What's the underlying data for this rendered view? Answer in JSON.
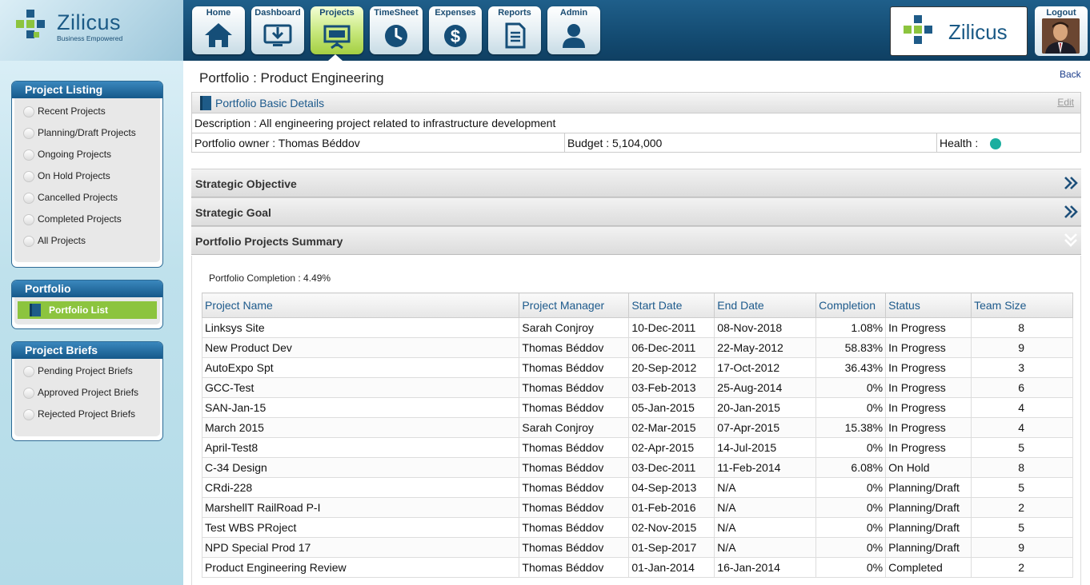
{
  "brand": {
    "name": "Zilicus",
    "tagline": "Business Empowered",
    "colors": {
      "green": "#8cc43e",
      "blue": "#1e5b88",
      "teal": "#1aae9f"
    }
  },
  "nav": {
    "items": [
      {
        "label": "Home",
        "icon": "home-icon"
      },
      {
        "label": "Dashboard",
        "icon": "dashboard-icon"
      },
      {
        "label": "Projects",
        "icon": "projects-icon",
        "active": true
      },
      {
        "label": "TimeSheet",
        "icon": "clock-icon"
      },
      {
        "label": "Expenses",
        "icon": "dollar-icon"
      },
      {
        "label": "Reports",
        "icon": "document-icon"
      },
      {
        "label": "Admin",
        "icon": "user-icon"
      }
    ],
    "logout_label": "Logout"
  },
  "sidebar": {
    "project_listing": {
      "title": "Project Listing",
      "items": [
        "Recent Projects",
        "Planning/Draft Projects",
        "Ongoing Projects",
        "On Hold Projects",
        "Cancelled Projects",
        "Completed Projects",
        "All Projects"
      ]
    },
    "portfolio": {
      "title": "Portfolio",
      "item": "Portfolio List"
    },
    "project_briefs": {
      "title": "Project Briefs",
      "items": [
        "Pending Project Briefs",
        "Approved Project Briefs",
        "Rejected Project Briefs"
      ]
    }
  },
  "main": {
    "title": "Portfolio : Product Engineering",
    "back": "Back",
    "details": {
      "title": "Portfolio Basic Details",
      "edit": "Edit",
      "description": "Description : All engineering project related to infrastructure development",
      "owner": "Portfolio owner : Thomas Béddov",
      "budget": "Budget : 5,104,000",
      "health": "Health :",
      "health_color": "#1aae9f"
    },
    "sections": {
      "objective": "Strategic Objective",
      "goal": "Strategic Goal",
      "summary": "Portfolio Projects Summary"
    },
    "completion": "Portfolio Completion : 4.49%",
    "table": {
      "headers": [
        "Project Name",
        "Project Manager",
        "Start Date",
        "End Date",
        "Completion",
        "Status",
        "Team Size"
      ],
      "rows": [
        [
          "Linksys Site",
          "Sarah Conjroy",
          "10-Dec-2011",
          "08-Nov-2018",
          "1.08%",
          "In Progress",
          "8"
        ],
        [
          "New Product Dev",
          "Thomas Béddov",
          "06-Dec-2011",
          "22-May-2012",
          "58.83%",
          "In Progress",
          "9"
        ],
        [
          "AutoExpo Spt",
          "Thomas Béddov",
          "20-Sep-2012",
          "17-Oct-2012",
          "36.43%",
          "In Progress",
          "3"
        ],
        [
          "GCC-Test",
          "Thomas Béddov",
          "03-Feb-2013",
          "25-Aug-2014",
          "0%",
          "In Progress",
          "6"
        ],
        [
          "SAN-Jan-15",
          "Thomas Béddov",
          "05-Jan-2015",
          "20-Jan-2015",
          "0%",
          "In Progress",
          "4"
        ],
        [
          "March 2015",
          "Sarah Conjroy",
          "02-Mar-2015",
          "07-Apr-2015",
          "15.38%",
          "In Progress",
          "4"
        ],
        [
          "April-Test8",
          "Thomas Béddov",
          "02-Apr-2015",
          "14-Jul-2015",
          "0%",
          "In Progress",
          "5"
        ],
        [
          "C-34 Design",
          "Thomas Béddov",
          "03-Dec-2011",
          "11-Feb-2014",
          "6.08%",
          "On Hold",
          "8"
        ],
        [
          "CRdi-228",
          "Thomas Béddov",
          "04-Sep-2013",
          "N/A",
          "0%",
          "Planning/Draft",
          "5"
        ],
        [
          "MarshellT RailRoad P-I",
          "Thomas Béddov",
          "01-Feb-2016",
          "N/A",
          "0%",
          "Planning/Draft",
          "2"
        ],
        [
          "Test WBS PRoject",
          "Thomas Béddov",
          "02-Nov-2015",
          "N/A",
          "0%",
          "Planning/Draft",
          "5"
        ],
        [
          "NPD Special Prod 17",
          "Thomas Béddov",
          "01-Sep-2017",
          "N/A",
          "0%",
          "Planning/Draft",
          "9"
        ],
        [
          "Product Engineering Review",
          "Thomas Béddov",
          "01-Jan-2014",
          "16-Jan-2014",
          "0%",
          "Completed",
          "2"
        ]
      ]
    }
  }
}
